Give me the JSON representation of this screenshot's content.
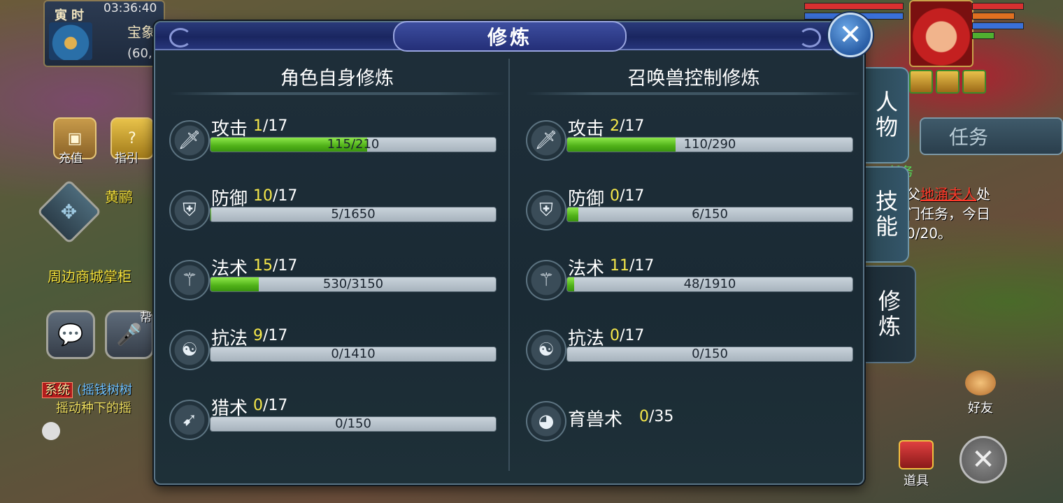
{
  "hud": {
    "shichen": "寅时",
    "clock": "03:36:40",
    "place": "宝象",
    "coord": "(60,",
    "recharge": "充值",
    "guide": "指引",
    "guide_partial": "引",
    "npc_name": "黄鹂",
    "shop_hint": "周边商城掌柜",
    "help_partial": "帮",
    "chat_tag": "系统",
    "chat_line1": "(摇钱树树",
    "chat_line2": "摇动种下的摇",
    "task_tab": "任务",
    "task_head": "任务",
    "task_line1_a": "父",
    "task_line1_red": "地涌夫人",
    "task_line1_b": "处",
    "task_line2": "门任务，今日",
    "task_line3": "0/20。",
    "friend": "好友",
    "items": "道具",
    "shu": "术"
  },
  "panel": {
    "title": "修炼",
    "left_header": "角色自身修炼",
    "right_header": "召唤兽控制修炼",
    "left_rows": [
      {
        "name": "攻击",
        "cur": "1",
        "max": "/17",
        "progress": "115/210",
        "fill": 0.548,
        "icon": "sword-icon"
      },
      {
        "name": "防御",
        "cur": "10",
        "max": "/17",
        "progress": "5/1650",
        "fill": 0.003,
        "icon": "shield-icon"
      },
      {
        "name": "法术",
        "cur": "15",
        "max": "/17",
        "progress": "530/3150",
        "fill": 0.168,
        "icon": "staff-icon"
      },
      {
        "name": "抗法",
        "cur": "9",
        "max": "/17",
        "progress": "0/1410",
        "fill": 0,
        "icon": "yinyang-icon"
      },
      {
        "name": "猎术",
        "cur": "0",
        "max": "/17",
        "progress": "0/150",
        "fill": 0,
        "icon": "bow-icon"
      }
    ],
    "right_rows": [
      {
        "name": "攻击",
        "cur": "2",
        "max": "/17",
        "progress": "110/290",
        "fill": 0.379,
        "icon": "sword-icon"
      },
      {
        "name": "防御",
        "cur": "0",
        "max": "/17",
        "progress": "6/150",
        "fill": 0.04,
        "icon": "shield-icon"
      },
      {
        "name": "法术",
        "cur": "11",
        "max": "/17",
        "progress": "48/1910",
        "fill": 0.025,
        "icon": "staff-icon"
      },
      {
        "name": "抗法",
        "cur": "0",
        "max": "/17",
        "progress": "0/150",
        "fill": 0,
        "icon": "yinyang-icon"
      }
    ],
    "beast": {
      "name": "育兽术",
      "cur": "0",
      "max": "/35",
      "icon": "beast-icon"
    },
    "tabs": [
      "人物",
      "技能",
      "修炼"
    ],
    "close_symbol": "✕"
  },
  "colors": {
    "level_current": "#f6e84a",
    "bar_fill": "#4fb018",
    "title_bar": "#1a2660"
  }
}
